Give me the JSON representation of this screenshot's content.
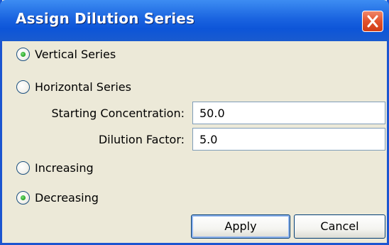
{
  "window": {
    "title": "Assign Dilution Series",
    "close_icon": "close-icon"
  },
  "series_orientation": {
    "options": [
      {
        "label": "Vertical Series",
        "selected": true
      },
      {
        "label": "Horizontal Series",
        "selected": false
      }
    ]
  },
  "fields": {
    "starting_concentration": {
      "label": "Starting Concentration:",
      "value": "50.0"
    },
    "dilution_factor": {
      "label": "Dilution Factor:",
      "value": "5.0"
    }
  },
  "direction": {
    "options": [
      {
        "label": "Increasing",
        "selected": false
      },
      {
        "label": "Decreasing",
        "selected": true
      }
    ]
  },
  "buttons": {
    "apply_label": "Apply",
    "cancel_label": "Cancel"
  },
  "colors": {
    "title_bar": "#0d55d8",
    "close_button": "#e2522d",
    "dialog_background": "#ece9d8",
    "radio_selected_dot": "#21a121"
  }
}
